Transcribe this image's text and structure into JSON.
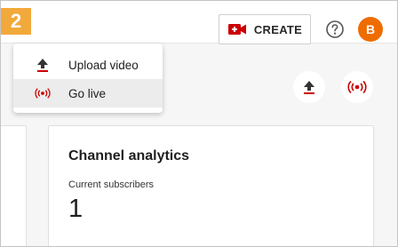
{
  "step_badge": "2",
  "header": {
    "create_label": "CREATE",
    "avatar_letter": "B"
  },
  "menu": {
    "items": [
      {
        "icon": "upload-icon",
        "label": "Upload video"
      },
      {
        "icon": "go-live-icon",
        "label": "Go live"
      }
    ]
  },
  "analytics": {
    "title": "Channel analytics",
    "subscribers_label": "Current subscribers",
    "subscribers_value": "1"
  },
  "colors": {
    "brand_red": "#cc0000",
    "badge_orange": "#f2a93b",
    "avatar_orange": "#ef6c00"
  }
}
